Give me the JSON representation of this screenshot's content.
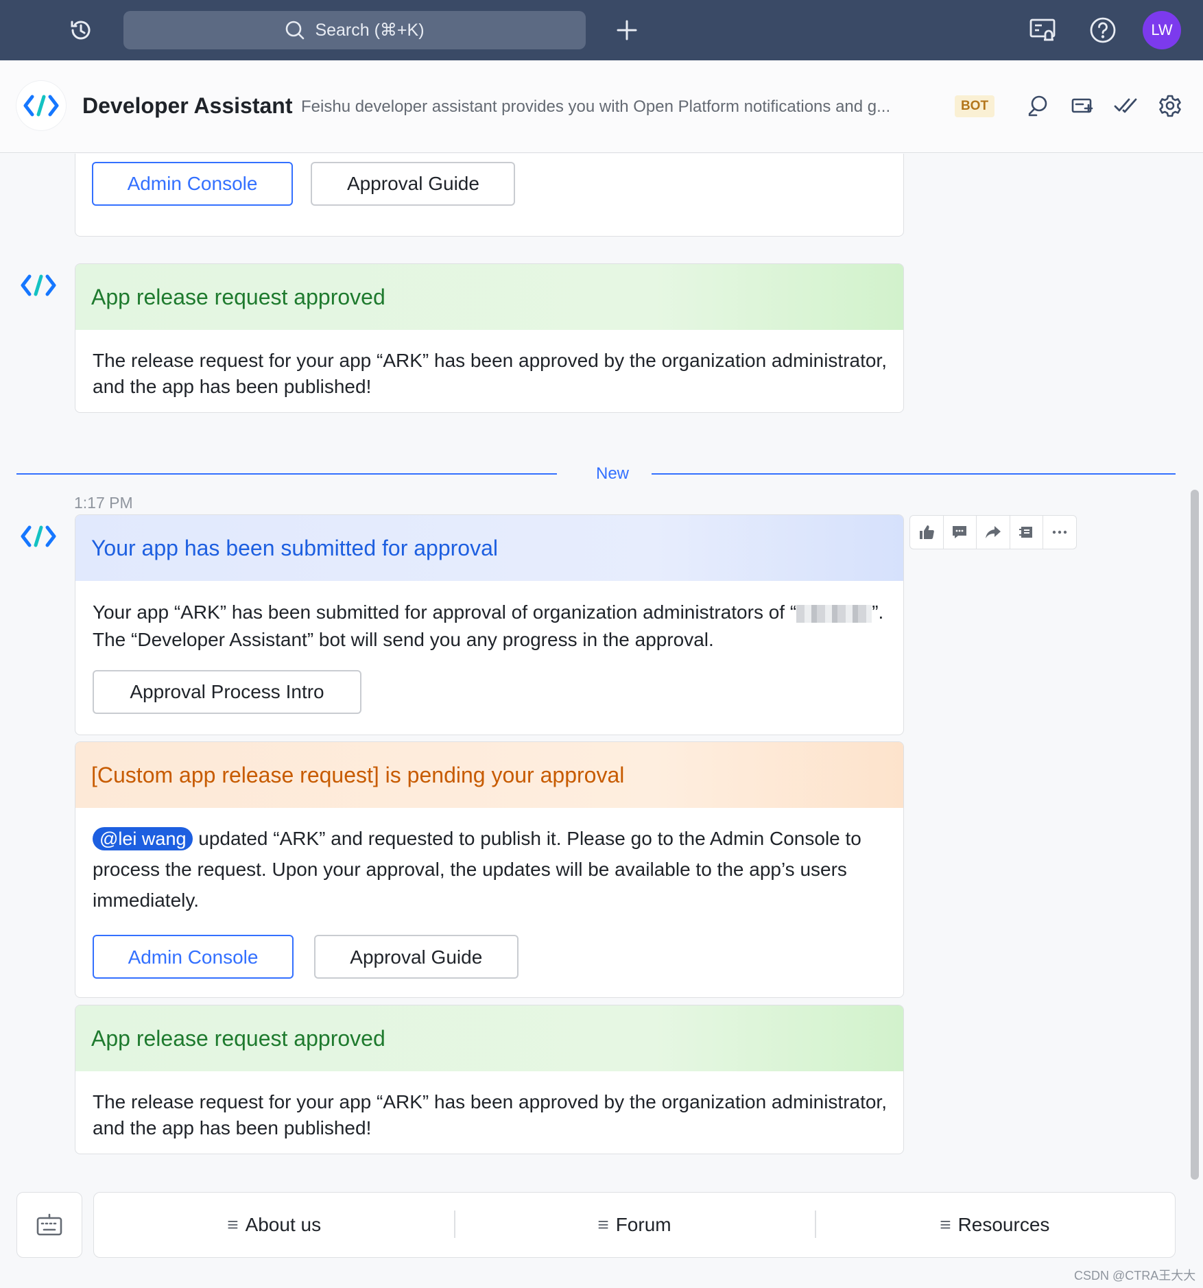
{
  "topbar": {
    "search_placeholder": "Search (⌘+K)",
    "avatar_initials": "LW",
    "avatar_color": "#7c3aed"
  },
  "chat": {
    "title": "Developer Assistant",
    "description": "Feishu developer assistant provides you with Open Platform notifications and g...",
    "badge": "BOT"
  },
  "messages": {
    "partial_card": {
      "primary_button": "Admin Console",
      "secondary_button": "Approval Guide"
    },
    "approved_card_1": {
      "title": "App release request approved",
      "body": "The release request for your app “ARK” has been approved by the organization administrator, and the app has been published!"
    },
    "new_divider": "New",
    "timestamp": "1:17 PM",
    "submitted_card": {
      "title": "Your app has been submitted for approval",
      "body_part1": "Your app “ARK” has been submitted for approval of organization administrators of “",
      "body_part2": "”. The “Developer Assistant” bot will send you any progress in the approval.",
      "button": "Approval Process Intro"
    },
    "pending_card": {
      "title": "[Custom app release request] is pending your approval",
      "mention": "@lei wang",
      "body": " updated “ARK” and requested to publish it. Please go to the Admin Console to process the request. Upon your approval, the updates will be available to the app’s users immediately.",
      "primary_button": "Admin Console",
      "secondary_button": "Approval Guide"
    },
    "approved_card_2": {
      "title": "App release request approved",
      "body": "The release request for your app “ARK” has been approved by the organization administrator, and the app has been published!"
    }
  },
  "message_actions": [
    "thumbs-up-icon",
    "reply-icon",
    "forward-icon",
    "pin-icon",
    "more-icon"
  ],
  "bottom_menu": {
    "items": [
      {
        "label": "About us"
      },
      {
        "label": "Forum"
      },
      {
        "label": "Resources"
      }
    ]
  },
  "watermark": "CSDN @CTRA王大大",
  "colors": {
    "accent": "#3370ff",
    "topbar": "#3a4a66",
    "approved_green": "#1e7a2e",
    "submitted_blue": "#1d5fe0",
    "pending_orange": "#c75b00"
  }
}
